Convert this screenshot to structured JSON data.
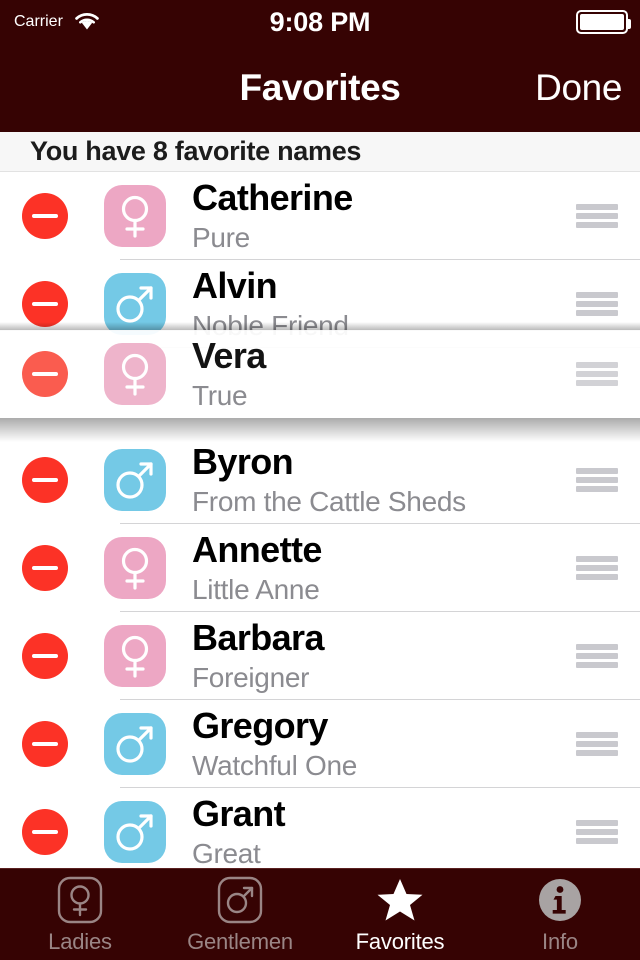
{
  "status_bar": {
    "carrier": "Carrier",
    "wifi_icon": "wifi-icon",
    "time": "9:08 PM",
    "battery_icon": "battery-full-icon"
  },
  "nav_bar": {
    "title": "Favorites",
    "done_label": "Done"
  },
  "section_header": {
    "text": "You have 8 favorite names"
  },
  "list": {
    "delete_icon": "minus-circle-icon",
    "reorder_icon": "reorder-handle-icon",
    "rows": [
      {
        "name": "Catherine",
        "meaning": "Pure",
        "gender": "female",
        "gender_icon": "venus-icon",
        "dragging": false
      },
      {
        "name": "Alvin",
        "meaning": "Noble Friend",
        "gender": "male",
        "gender_icon": "mars-icon",
        "dragging": false
      },
      {
        "name": "Vera",
        "meaning": "True",
        "gender": "female",
        "gender_icon": "venus-icon",
        "dragging": true
      },
      {
        "name": "Byron",
        "meaning": "From the Cattle Sheds",
        "gender": "male",
        "gender_icon": "mars-icon",
        "dragging": false
      },
      {
        "name": "Annette",
        "meaning": "Little Anne",
        "gender": "female",
        "gender_icon": "venus-icon",
        "dragging": false
      },
      {
        "name": "Barbara",
        "meaning": "Foreigner",
        "gender": "female",
        "gender_icon": "venus-icon",
        "dragging": false
      },
      {
        "name": "Gregory",
        "meaning": "Watchful One",
        "gender": "male",
        "gender_icon": "mars-icon",
        "dragging": false
      },
      {
        "name": "Grant",
        "meaning": "Great",
        "gender": "male",
        "gender_icon": "mars-icon",
        "dragging": false
      }
    ]
  },
  "tab_bar": {
    "tabs": [
      {
        "label": "Ladies",
        "icon": "venus-outline-icon",
        "active": false
      },
      {
        "label": "Gentlemen",
        "icon": "mars-outline-icon",
        "active": false
      },
      {
        "label": "Favorites",
        "icon": "star-icon",
        "active": true
      },
      {
        "label": "Info",
        "icon": "info-circle-icon",
        "active": false
      }
    ]
  },
  "colors": {
    "bar_background": "#360303",
    "delete_red": "#FC3226",
    "female_pink": "#EDA7C4",
    "male_blue": "#74C9E6",
    "subtitle_gray": "#8B8B90",
    "separator": "#D4D4D6",
    "reorder_gray": "#C9C9CE",
    "header_background": "#F7F7F7",
    "tab_inactive": "#9A8585",
    "tab_active": "#FFFFFF"
  }
}
